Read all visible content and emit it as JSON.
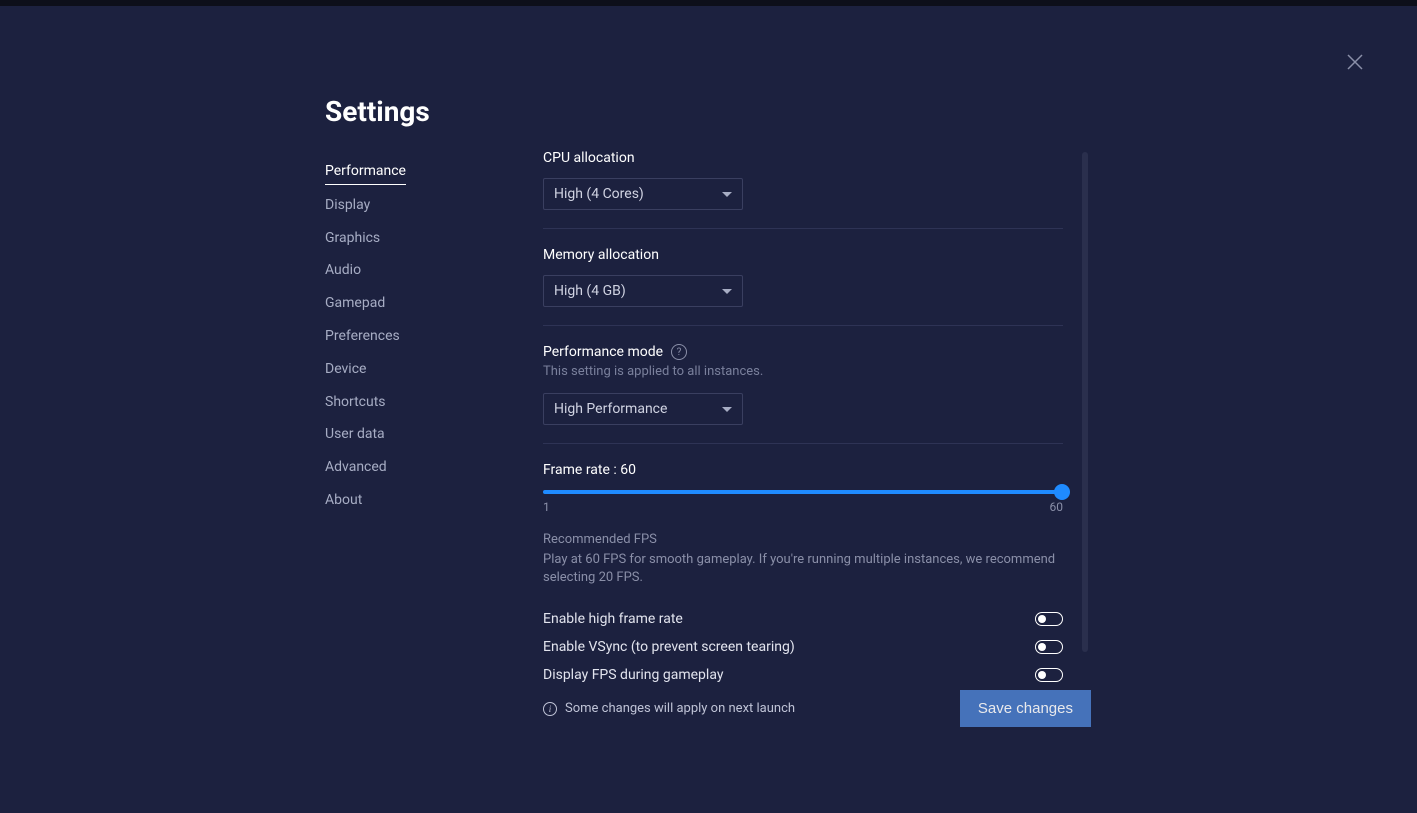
{
  "title": "Settings",
  "sidebar": {
    "items": [
      {
        "label": "Performance",
        "active": true
      },
      {
        "label": "Display"
      },
      {
        "label": "Graphics"
      },
      {
        "label": "Audio"
      },
      {
        "label": "Gamepad"
      },
      {
        "label": "Preferences"
      },
      {
        "label": "Device"
      },
      {
        "label": "Shortcuts"
      },
      {
        "label": "User data"
      },
      {
        "label": "Advanced"
      },
      {
        "label": "About"
      }
    ]
  },
  "main": {
    "cpu": {
      "label": "CPU allocation",
      "value": "High (4 Cores)"
    },
    "memory": {
      "label": "Memory allocation",
      "value": "High (4 GB)"
    },
    "perfmode": {
      "label": "Performance mode",
      "note": "This setting is applied to all instances.",
      "value": "High Performance"
    },
    "framerate": {
      "label": "Frame rate : 60",
      "min": "1",
      "max": "60",
      "rec_title": "Recommended FPS",
      "rec_text": "Play at 60 FPS for smooth gameplay. If you're running multiple instances, we recommend selecting 20 FPS."
    },
    "toggles": {
      "high_fps": "Enable high frame rate",
      "vsync": "Enable VSync (to prevent screen tearing)",
      "display_fps": "Display FPS during gameplay"
    }
  },
  "footer": {
    "note": "Some changes will apply on next launch",
    "save": "Save changes"
  }
}
